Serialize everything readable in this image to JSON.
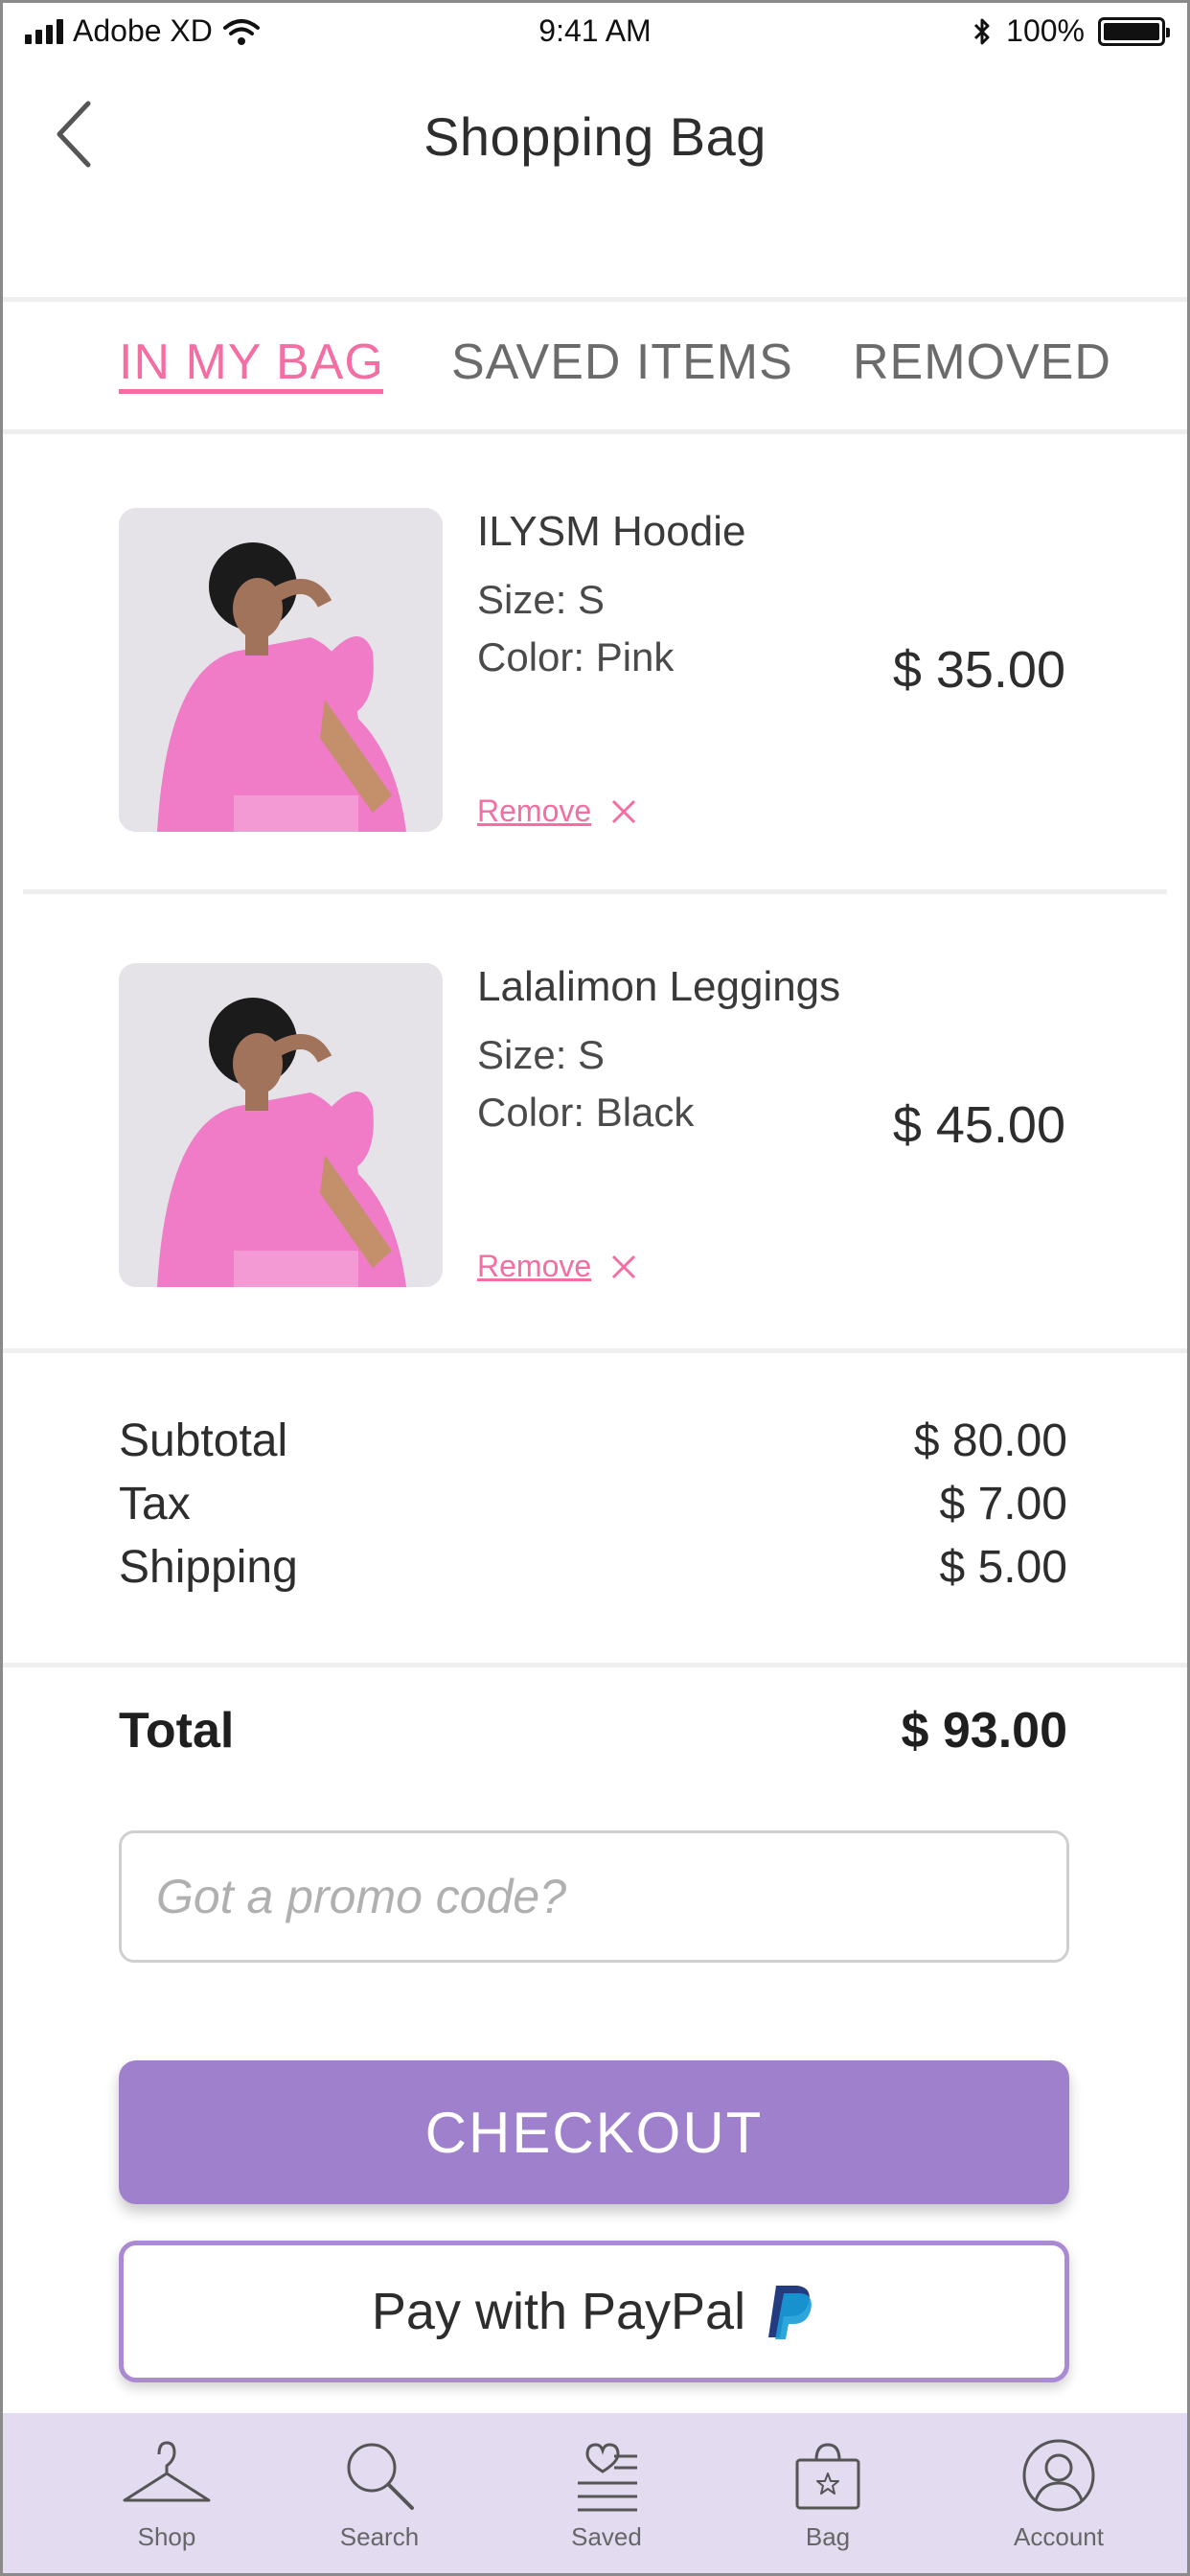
{
  "status_bar": {
    "carrier": "Adobe XD",
    "time": "9:41 AM",
    "battery": "100%"
  },
  "header": {
    "title": "Shopping Bag"
  },
  "tabs": [
    {
      "label": "IN MY BAG",
      "active": true
    },
    {
      "label": "SAVED ITEMS",
      "active": false
    },
    {
      "label": "REMOVED",
      "active": false
    }
  ],
  "items": [
    {
      "name": "ILYSM Hoodie",
      "size": "Size: S",
      "color": "Color: Pink",
      "price": "$ 35.00",
      "remove_label": "Remove"
    },
    {
      "name": "Lalalimon Leggings",
      "size": "Size: S",
      "color": "Color: Black",
      "price": "$ 45.00",
      "remove_label": "Remove"
    }
  ],
  "summary": {
    "subtotal_label": "Subtotal",
    "subtotal_value": "$ 80.00",
    "tax_label": "Tax",
    "tax_value": "$ 7.00",
    "shipping_label": "Shipping",
    "shipping_value": "$ 5.00",
    "total_label": "Total",
    "total_value": "$ 93.00"
  },
  "promo": {
    "placeholder": "Got a promo code?"
  },
  "checkout": {
    "label": "CHECKOUT"
  },
  "paypal": {
    "label": "Pay with PayPal"
  },
  "bottom_nav": [
    {
      "label": "Shop",
      "icon": "hanger-icon"
    },
    {
      "label": "Search",
      "icon": "search-icon"
    },
    {
      "label": "Saved",
      "icon": "heart-list-icon"
    },
    {
      "label": "Bag",
      "icon": "bag-icon"
    },
    {
      "label": "Account",
      "icon": "account-icon"
    }
  ],
  "colors": {
    "accent_pink": "#f36ea3",
    "checkout_purple": "#9e80cc",
    "tabbar_bg": "#e3dbf0"
  }
}
